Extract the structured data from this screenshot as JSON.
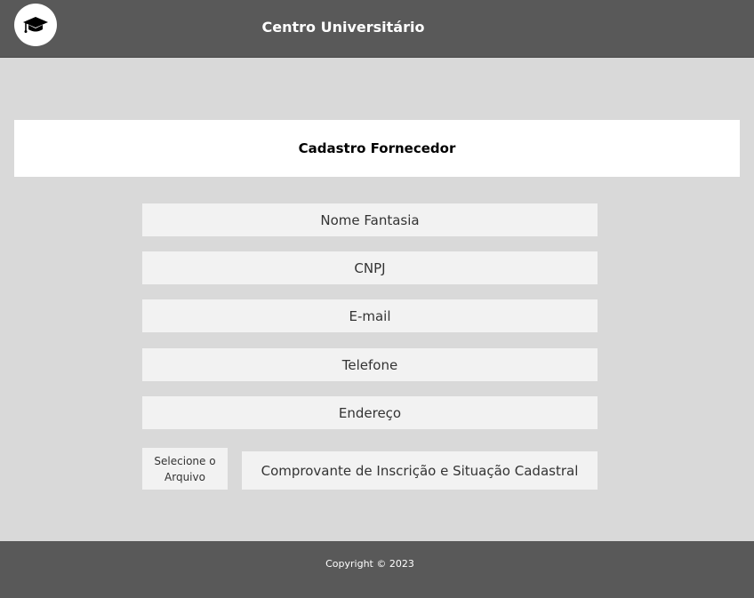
{
  "header": {
    "logo_icon": "graduation-cap-icon",
    "app_title": "Centro Universitário"
  },
  "form": {
    "title": "Cadastro Fornecedor",
    "fields": {
      "nome_fantasia": "Nome Fantasia",
      "cnpj": "CNPJ",
      "email": "E-mail",
      "telefone": "Telefone",
      "endereco": "Endereço"
    },
    "file_button_label": "Selecione o Arquivo",
    "file_label": "Comprovante de Inscrição e Situação Cadastral"
  },
  "footer": {
    "copyright": "Copyright © 2023"
  },
  "colors": {
    "header_bg": "#595959",
    "page_bg": "#d9d9d9",
    "field_bg": "#f2f2f2",
    "panel_bg": "#ffffff"
  }
}
